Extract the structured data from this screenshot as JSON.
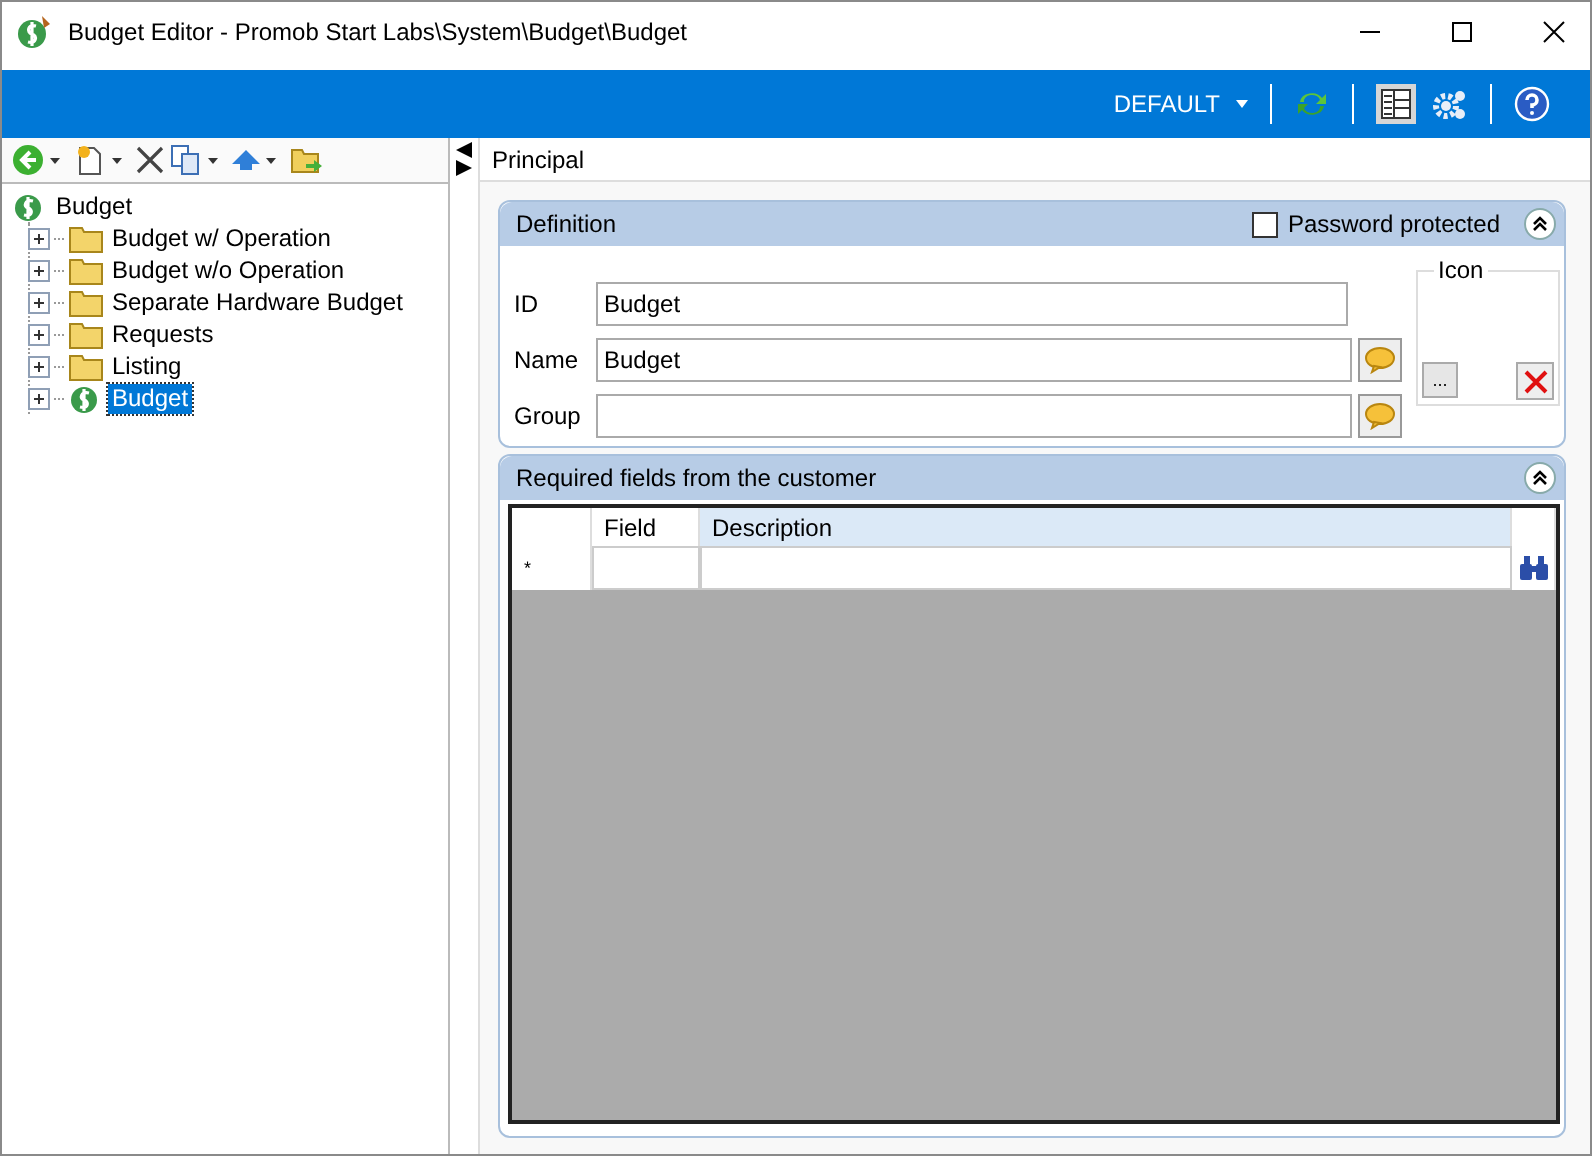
{
  "window": {
    "title": "Budget Editor - Promob Start Labs\\System\\Budget\\Budget"
  },
  "header_bar": {
    "profile": "DEFAULT"
  },
  "tree": {
    "label": "Budget",
    "kind": "budget",
    "selected": false,
    "children": [
      {
        "label": "Budget w/ Operation",
        "kind": "folder",
        "expanded": false,
        "selected": false
      },
      {
        "label": "Budget w/o Operation",
        "kind": "folder",
        "expanded": false,
        "selected": false
      },
      {
        "label": "Separate Hardware Budget",
        "kind": "folder",
        "expanded": false,
        "selected": false
      },
      {
        "label": "Requests",
        "kind": "folder",
        "expanded": false,
        "selected": false
      },
      {
        "label": "Listing",
        "kind": "folder",
        "expanded": false,
        "selected": false
      },
      {
        "label": "Budget",
        "kind": "budget",
        "expanded": false,
        "selected": true
      }
    ]
  },
  "tab": {
    "label": "Principal"
  },
  "definition": {
    "title": "Definition",
    "password_protected": {
      "label": "Password protected",
      "checked": false
    },
    "icon_group": {
      "label": "Icon",
      "browse": "..."
    },
    "fields": [
      {
        "label": "ID",
        "value": "Budget",
        "translatable": false
      },
      {
        "label": "Name",
        "value": "Budget",
        "translatable": true
      },
      {
        "label": "Group",
        "translatable": true
      }
    ]
  },
  "required_fields": {
    "title": "Required fields from the customer",
    "columns": [
      "Field",
      "Description"
    ],
    "new_row_marker": "*"
  }
}
